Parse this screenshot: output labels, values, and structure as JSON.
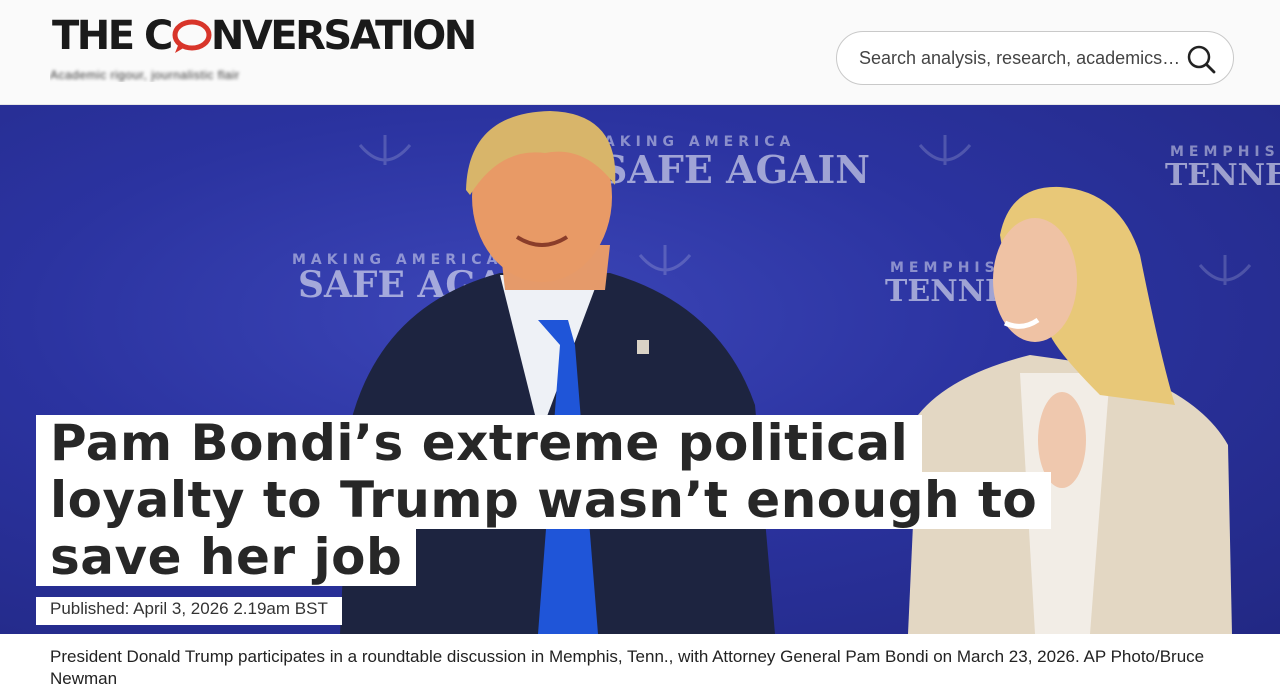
{
  "header": {
    "logo_before": "THE C",
    "logo_after": "NVERSATION",
    "tagline": "Academic rigour, journalistic flair",
    "search": {
      "placeholder": "Search analysis, research, academics…"
    }
  },
  "hero": {
    "backdrop_texts": [
      "MAKING AMERICA",
      "SAFE AGAIN",
      "MEMPHIS",
      "TENNESSEE",
      "MAKING AMERICA",
      "SAFE AGAIN",
      "MEMPHIS",
      "TENNESSEE"
    ],
    "headline_lines": [
      "Pam Bondi’s extreme political",
      "loyalty to Trump wasn’t enough to",
      "save her job"
    ],
    "published": "Published: April 3, 2026 2.19am BST"
  },
  "caption": "President Donald Trump participates in a roundtable discussion in Memphis, Tenn., with Attorney General Pam Bondi on March 23, 2026. AP Photo/Bruce Newman",
  "colors": {
    "logo_accent": "#d8352a",
    "backdrop_blue": "#2b33a0",
    "text": "#272727"
  },
  "icons": {
    "search": "search-icon",
    "logo_bubble": "speech-bubble-icon"
  }
}
